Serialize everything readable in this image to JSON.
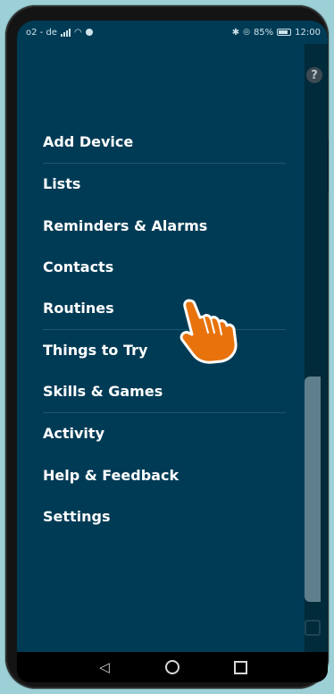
{
  "status_bar": {
    "carrier": "o2 - de",
    "battery": "85%",
    "time": "12:00"
  },
  "help_icon_glyph": "?",
  "menu": {
    "items": [
      {
        "label": "Add Device",
        "icon": "none"
      },
      {
        "label": "Lists"
      },
      {
        "label": "Reminders & Alarms"
      },
      {
        "label": "Contacts"
      },
      {
        "label": "Routines"
      },
      {
        "label": "Things to Try"
      },
      {
        "label": "Skills & Games"
      },
      {
        "label": "Activity"
      },
      {
        "label": "Help & Feedback"
      },
      {
        "label": "Settings"
      }
    ]
  },
  "nav_bar": {
    "back_icon": "triangle-back-icon",
    "home_icon": "circle-home-icon",
    "recents_icon": "square-recents-icon"
  },
  "colors": {
    "drawer_bg": "#003b55",
    "pointer_hand": "#e8730c"
  }
}
